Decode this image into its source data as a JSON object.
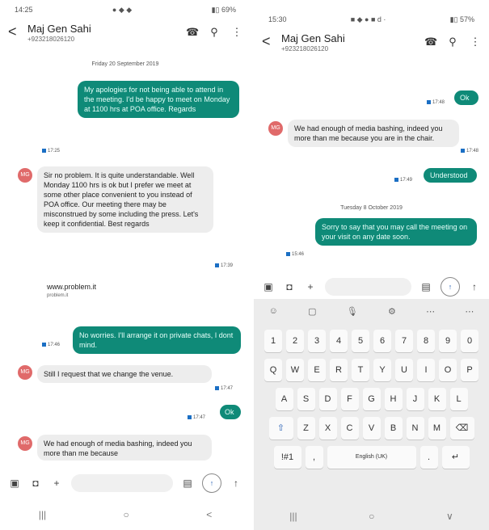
{
  "left": {
    "status": {
      "time": "14:25",
      "icons": "● ◆ ◆",
      "right": "▮▯ 69%"
    },
    "contact": {
      "name": "Maj Gen Sahi",
      "number": "+923218026120"
    },
    "date_sep": "Friday 20 September 2019",
    "msgs": [
      {
        "text": "My apologies for not being able to attend in the meeting. I'd be happy to meet on Monday at 1100 hrs at POA office. Regards",
        "time": "17:25"
      },
      {
        "text": "Sir no problem. It is quite understandable. Well Monday 1100 hrs is ok but I prefer we meet at some other place convenient to you instead of POA office. Our meeting there may be misconstrued by some including the press. Let's keep it confidential. Best regards",
        "time": "17:39"
      },
      {
        "text": "www.problem.it",
        "sub": "problem.it"
      },
      {
        "text": "No worries. I'll arrange it on private chats, I dont mind.",
        "time": "17:46"
      },
      {
        "text": "Still I request that we change the venue.",
        "time": "17:47"
      },
      {
        "text": "Ok",
        "time": "17:47"
      },
      {
        "text": "We had enough of media bashing, indeed you more than me because"
      }
    ],
    "nav": [
      "|||",
      "○",
      "<"
    ]
  },
  "right": {
    "status": {
      "time": "15:30",
      "icons": "■ ◆ ● ■ d ·",
      "right": "▮▯ 57%"
    },
    "contact": {
      "name": "Maj Gen Sahi",
      "number": "+923218026120"
    },
    "date_sep": "Tuesday 8 October 2019",
    "msgs": [
      {
        "text": "Ok",
        "time": "17:48"
      },
      {
        "text": "We had enough of media bashing, indeed you more than me because you are in the chair.",
        "time": "17:48"
      },
      {
        "text": "Understood",
        "time": "17:49"
      },
      {
        "text": "Sorry to say that you may call the meeting on your visit on any date soon.",
        "time": "15:46"
      }
    ],
    "keyboard": {
      "toolbar": [
        "☺",
        "▢",
        "🎙",
        "⚙",
        "⋯",
        "⋯"
      ],
      "row_nums": [
        "1",
        "2",
        "3",
        "4",
        "5",
        "6",
        "7",
        "8",
        "9",
        "0"
      ],
      "row1": [
        "Q",
        "W",
        "E",
        "R",
        "T",
        "Y",
        "U",
        "I",
        "O",
        "P"
      ],
      "row2": [
        "A",
        "S",
        "D",
        "F",
        "G",
        "H",
        "J",
        "K",
        "L"
      ],
      "row3": [
        "Z",
        "X",
        "C",
        "V",
        "B",
        "N",
        "M"
      ],
      "sym": "!#1",
      "comma": ",",
      "space": "English (UK)",
      "period": "."
    },
    "nav": [
      "|||",
      "○",
      "∨"
    ]
  },
  "icons": {
    "back": "<",
    "call": "☎",
    "search": "⚲",
    "menu": "⋮",
    "gallery": "▣",
    "camera": "◘",
    "plus": "+",
    "sticker": "▤",
    "send": "↑",
    "shift": "⇧",
    "backspace": "⌫",
    "enter": "↵"
  }
}
